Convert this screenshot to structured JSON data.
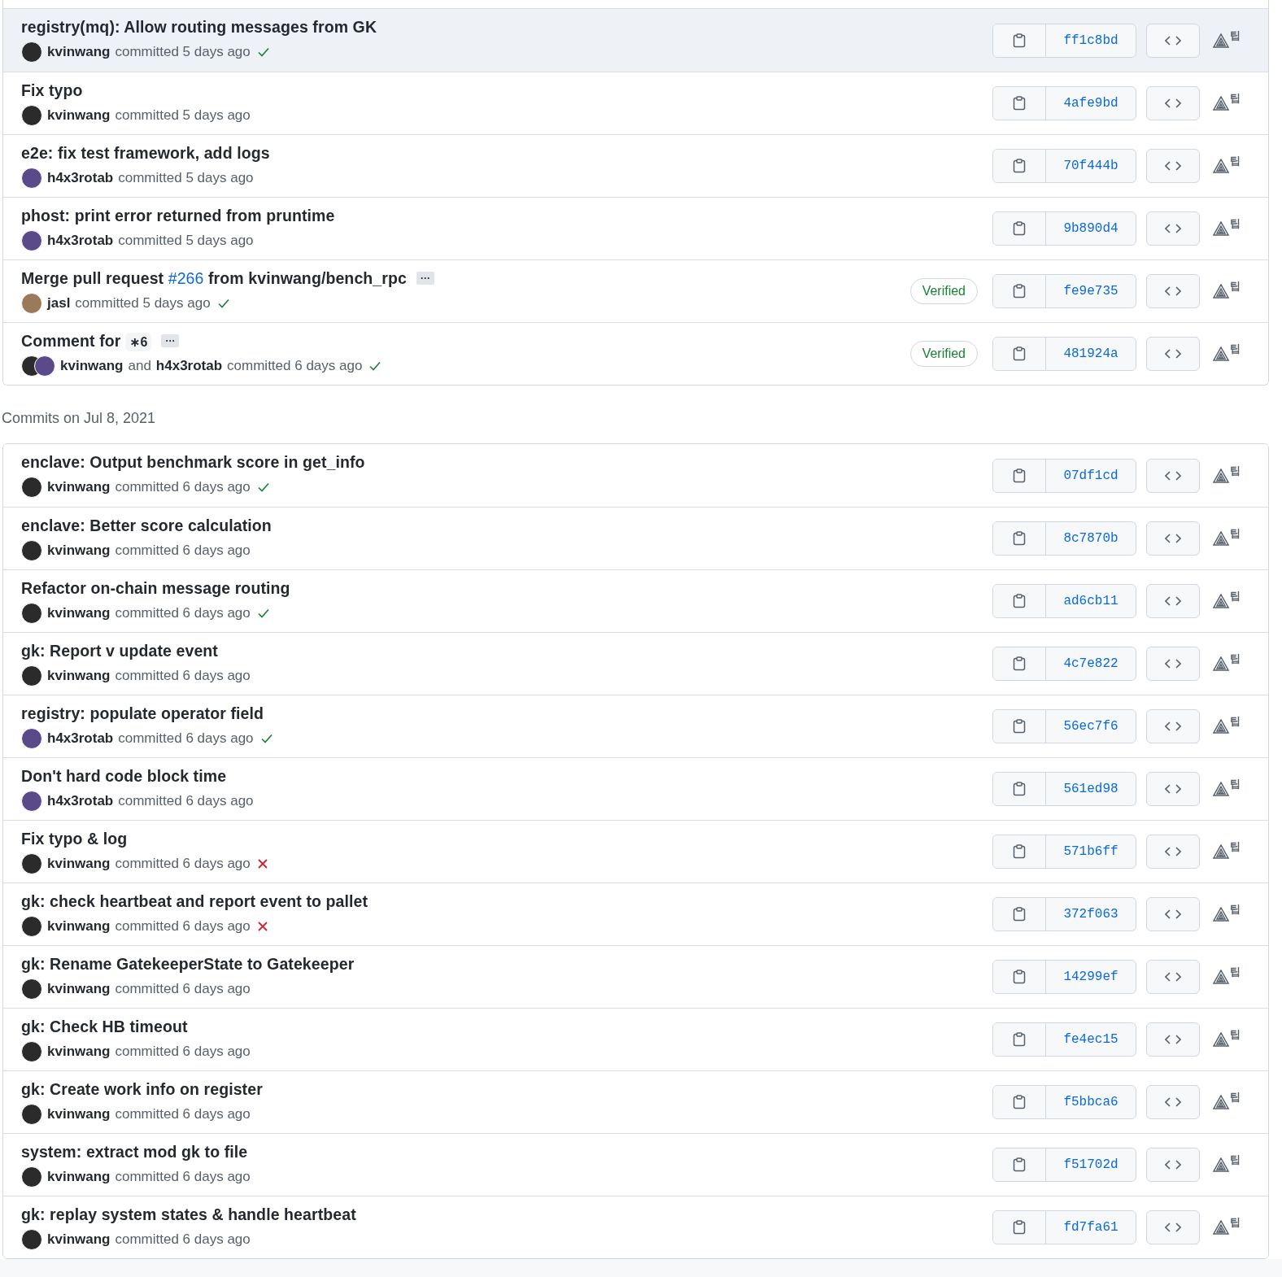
{
  "groups": [
    {
      "commits": [
        {
          "title": [
            {
              "kind": "text",
              "text": "registry(mq): Allow routing messages from GK"
            }
          ],
          "authors": [
            {
              "name": "kvinwang",
              "color": "#2b2b2b"
            }
          ],
          "committed": "committed 5 days ago",
          "passed": true,
          "failed": false,
          "sha": "ff1c8bd",
          "tip": "팁",
          "hovered": true
        },
        {
          "title": [
            {
              "kind": "text",
              "text": "Fix typo"
            }
          ],
          "authors": [
            {
              "name": "kvinwang",
              "color": "#2b2b2b"
            }
          ],
          "committed": "committed 5 days ago",
          "passed": false,
          "failed": false,
          "sha": "4afe9bd",
          "tip": "팁",
          "hovered": false
        },
        {
          "title": [
            {
              "kind": "text",
              "text": "e2e: fix test framework, add logs"
            }
          ],
          "authors": [
            {
              "name": "h4x3rotab",
              "color": "#5b4a8a"
            }
          ],
          "committed": "committed 5 days ago",
          "passed": false,
          "failed": false,
          "sha": "70f444b",
          "tip": "팁",
          "hovered": false
        },
        {
          "title": [
            {
              "kind": "text",
              "text": "phost: print error returned from pruntime"
            }
          ],
          "authors": [
            {
              "name": "h4x3rotab",
              "color": "#5b4a8a"
            }
          ],
          "committed": "committed 5 days ago",
          "passed": false,
          "failed": false,
          "sha": "9b890d4",
          "tip": "팁",
          "hovered": false
        },
        {
          "title": [
            {
              "kind": "text",
              "text": "Merge pull request "
            },
            {
              "kind": "link",
              "text": "#266"
            },
            {
              "kind": "text",
              "text": " from kvinwang/bench_rpc"
            }
          ],
          "more": "···",
          "authors": [
            {
              "name": "jasl",
              "color": "#9a7a5a"
            }
          ],
          "committed": "committed 5 days ago",
          "passed": true,
          "failed": false,
          "verified": "Verified",
          "sha": "fe9e735",
          "tip": "팁",
          "hovered": false
        },
        {
          "title": [
            {
              "kind": "text",
              "text": "Comment for "
            },
            {
              "kind": "code",
              "text": "∗6"
            }
          ],
          "more": "···",
          "authors": [
            {
              "name": "kvinwang",
              "color": "#2b2b2b"
            },
            {
              "name": "h4x3rotab",
              "color": "#5b4a8a"
            }
          ],
          "joiner": "and",
          "committed": "committed 6 days ago",
          "passed": true,
          "failed": false,
          "verified": "Verified",
          "sha": "481924a",
          "tip": "팁",
          "hovered": false
        }
      ]
    },
    {
      "heading": "Commits on Jul 8, 2021",
      "commits": [
        {
          "title": [
            {
              "kind": "text",
              "text": "enclave: Output benchmark score in get_info"
            }
          ],
          "authors": [
            {
              "name": "kvinwang",
              "color": "#2b2b2b"
            }
          ],
          "committed": "committed 6 days ago",
          "passed": true,
          "failed": false,
          "sha": "07df1cd",
          "tip": "팁",
          "hovered": false
        },
        {
          "title": [
            {
              "kind": "text",
              "text": "enclave: Better score calculation"
            }
          ],
          "authors": [
            {
              "name": "kvinwang",
              "color": "#2b2b2b"
            }
          ],
          "committed": "committed 6 days ago",
          "passed": false,
          "failed": false,
          "sha": "8c7870b",
          "tip": "팁",
          "hovered": false
        },
        {
          "title": [
            {
              "kind": "text",
              "text": "Refactor on-chain message routing"
            }
          ],
          "authors": [
            {
              "name": "kvinwang",
              "color": "#2b2b2b"
            }
          ],
          "committed": "committed 6 days ago",
          "passed": true,
          "failed": false,
          "sha": "ad6cb11",
          "tip": "팁",
          "hovered": false
        },
        {
          "title": [
            {
              "kind": "text",
              "text": "gk: Report v update event"
            }
          ],
          "authors": [
            {
              "name": "kvinwang",
              "color": "#2b2b2b"
            }
          ],
          "committed": "committed 6 days ago",
          "passed": false,
          "failed": false,
          "sha": "4c7e822",
          "tip": "팁",
          "hovered": false
        },
        {
          "title": [
            {
              "kind": "text",
              "text": "registry: populate operator field"
            }
          ],
          "authors": [
            {
              "name": "h4x3rotab",
              "color": "#5b4a8a"
            }
          ],
          "committed": "committed 6 days ago",
          "passed": true,
          "failed": false,
          "sha": "56ec7f6",
          "tip": "팁",
          "hovered": false
        },
        {
          "title": [
            {
              "kind": "text",
              "text": "Don't hard code block time"
            }
          ],
          "authors": [
            {
              "name": "h4x3rotab",
              "color": "#5b4a8a"
            }
          ],
          "committed": "committed 6 days ago",
          "passed": false,
          "failed": false,
          "sha": "561ed98",
          "tip": "팁",
          "hovered": false
        },
        {
          "title": [
            {
              "kind": "text",
              "text": "Fix typo & log"
            }
          ],
          "authors": [
            {
              "name": "kvinwang",
              "color": "#2b2b2b"
            }
          ],
          "committed": "committed 6 days ago",
          "passed": false,
          "failed": true,
          "sha": "571b6ff",
          "tip": "팁",
          "hovered": false
        },
        {
          "title": [
            {
              "kind": "text",
              "text": "gk: check heartbeat and report event to pallet"
            }
          ],
          "authors": [
            {
              "name": "kvinwang",
              "color": "#2b2b2b"
            }
          ],
          "committed": "committed 6 days ago",
          "passed": false,
          "failed": true,
          "sha": "372f063",
          "tip": "팁",
          "hovered": false
        },
        {
          "title": [
            {
              "kind": "text",
              "text": "gk: Rename GatekeeperState to Gatekeeper"
            }
          ],
          "authors": [
            {
              "name": "kvinwang",
              "color": "#2b2b2b"
            }
          ],
          "committed": "committed 6 days ago",
          "passed": false,
          "failed": false,
          "sha": "14299ef",
          "tip": "팁",
          "hovered": false
        },
        {
          "title": [
            {
              "kind": "text",
              "text": "gk: Check HB timeout"
            }
          ],
          "authors": [
            {
              "name": "kvinwang",
              "color": "#2b2b2b"
            }
          ],
          "committed": "committed 6 days ago",
          "passed": false,
          "failed": false,
          "sha": "fe4ec15",
          "tip": "팁",
          "hovered": false
        },
        {
          "title": [
            {
              "kind": "text",
              "text": "gk: Create work info on register"
            }
          ],
          "authors": [
            {
              "name": "kvinwang",
              "color": "#2b2b2b"
            }
          ],
          "committed": "committed 6 days ago",
          "passed": false,
          "failed": false,
          "sha": "f5bbca6",
          "tip": "팁",
          "hovered": false
        },
        {
          "title": [
            {
              "kind": "text",
              "text": "system: extract mod gk to file"
            }
          ],
          "authors": [
            {
              "name": "kvinwang",
              "color": "#2b2b2b"
            }
          ],
          "committed": "committed 6 days ago",
          "passed": false,
          "failed": false,
          "sha": "f51702d",
          "tip": "팁",
          "hovered": false
        },
        {
          "title": [
            {
              "kind": "text",
              "text": "gk: replay system states & handle heartbeat"
            }
          ],
          "authors": [
            {
              "name": "kvinwang",
              "color": "#2b2b2b"
            }
          ],
          "committed": "committed 6 days ago",
          "passed": false,
          "failed": false,
          "sha": "fd7fa61",
          "tip": "팁",
          "hovered": false
        }
      ]
    }
  ]
}
